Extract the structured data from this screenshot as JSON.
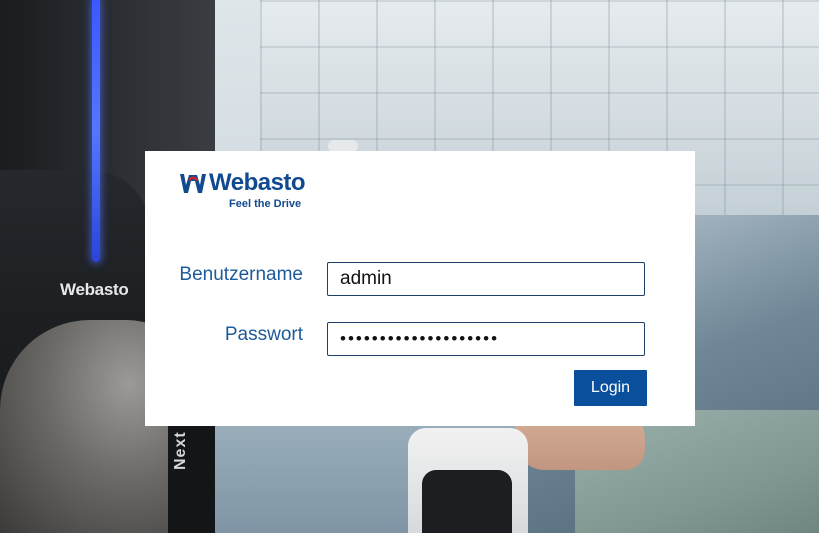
{
  "background": {
    "charger_logo_text": "Webasto",
    "charger_model_text": "Next"
  },
  "brand": {
    "name": "Webasto",
    "tagline": "Feel the Drive",
    "color": "#124a8f",
    "accent_color": "#d2232a"
  },
  "login": {
    "username_label": "Benutzername",
    "username_value": "admin",
    "password_label": "Passwort",
    "password_value": "••••••••••••••••••••",
    "submit_label": "Login",
    "button_color": "#0a4f9c"
  }
}
